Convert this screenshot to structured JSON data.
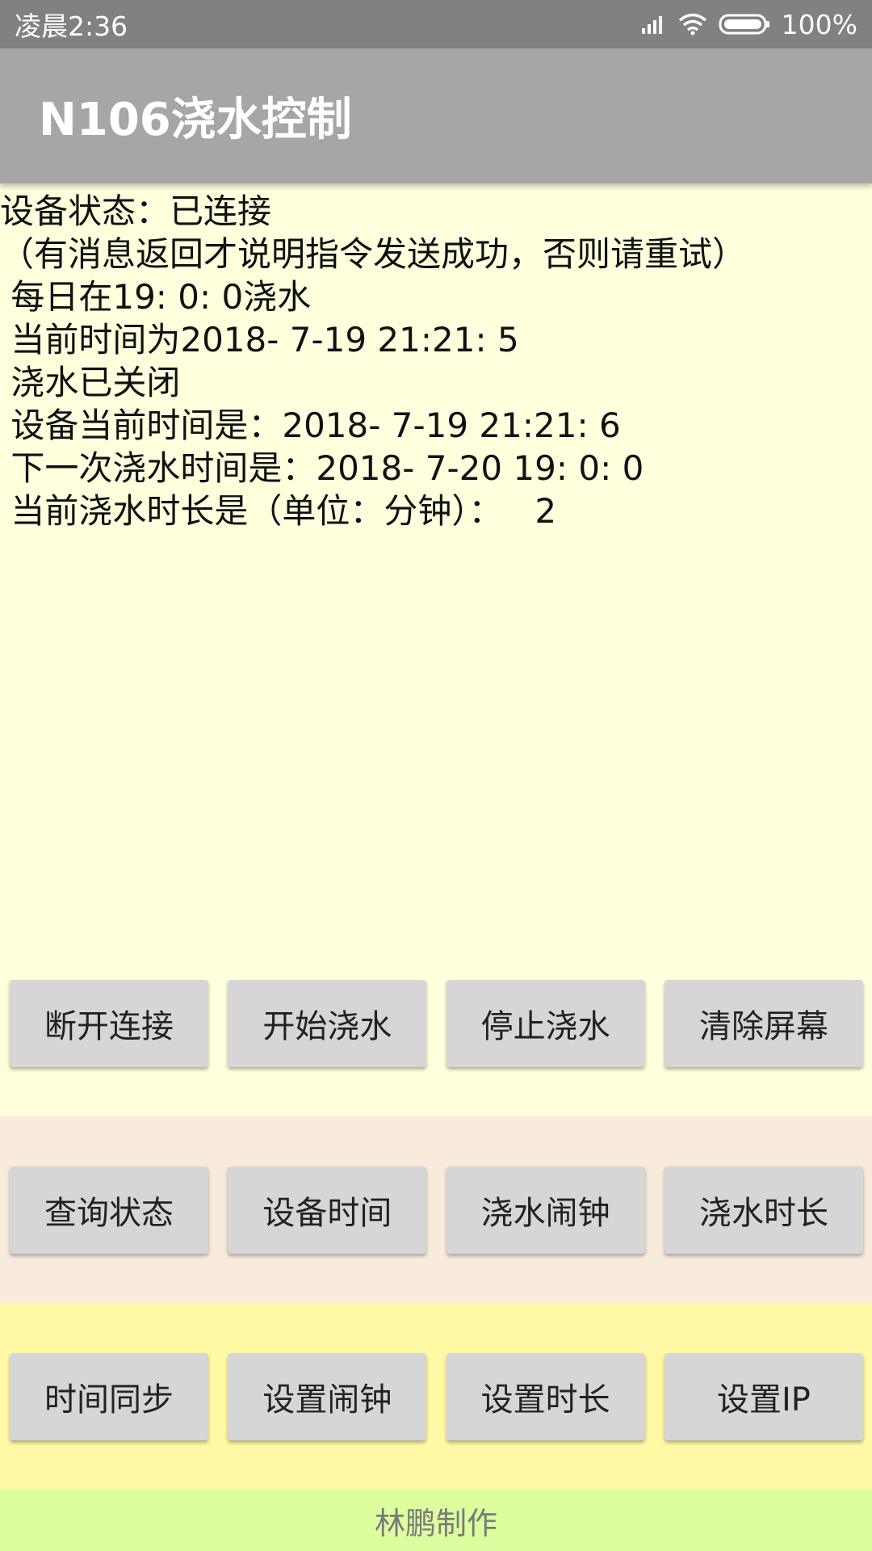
{
  "status_bar": {
    "time": "凌晨2:36",
    "battery_percent": "100%",
    "icons": [
      "signal-icon",
      "wifi-icon",
      "battery-icon"
    ],
    "color": "#818181"
  },
  "app_bar": {
    "title": "N106浇水控制",
    "color": "#a6a6a6"
  },
  "log": {
    "lines": [
      "设备状态：已连接",
      "（有消息返回才说明指令发送成功，否则请重试）",
      " 每日在19: 0: 0浇水",
      " 当前时间为2018- 7-19 21:21: 5",
      " 浇水已关闭",
      " 设备当前时间是：2018- 7-19 21:21: 6",
      " 下一次浇水时间是：2018- 7-20 19: 0: 0",
      " 当前浇水时长是（单位：分钟）：   2"
    ],
    "background": "#ffffde"
  },
  "button_rows": [
    {
      "background": "#ffffde",
      "buttons": [
        "断开连接",
        "开始浇水",
        "停止浇水",
        "清除屏幕"
      ]
    },
    {
      "background": "#f8ebdc",
      "buttons": [
        "查询状态",
        "设备时间",
        "浇水闹钟",
        "浇水时长"
      ]
    },
    {
      "background": "#fff9a6",
      "buttons": [
        "时间同步",
        "设置闹钟",
        "设置时长",
        "设置IP"
      ]
    }
  ],
  "footer": {
    "text": "林鹏制作",
    "background": "#dcfe9f"
  }
}
